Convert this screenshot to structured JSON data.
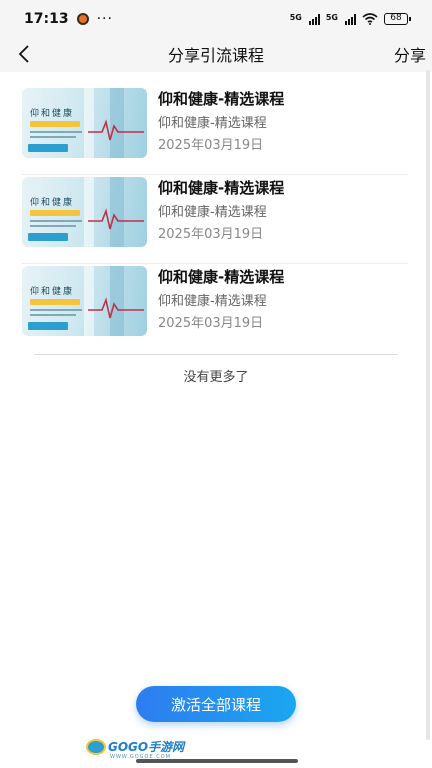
{
  "status_bar": {
    "time": "17:13",
    "dots": "···",
    "signal1_label": "5G",
    "signal2_label": "5G",
    "battery": "68"
  },
  "nav": {
    "back_icon": "chevron-left-icon",
    "title": "分享引流课程",
    "share_label": "分享"
  },
  "courses": [
    {
      "thumb_text": "仰和健康",
      "title": "仰和健康-精选课程",
      "subtitle": "仰和健康-精选课程",
      "date": "2025年03月19日"
    },
    {
      "thumb_text": "仰和健康",
      "title": "仰和健康-精选课程",
      "subtitle": "仰和健康-精选课程",
      "date": "2025年03月19日"
    },
    {
      "thumb_text": "仰和健康",
      "title": "仰和健康-精选课程",
      "subtitle": "仰和健康-精选课程",
      "date": "2025年03月19日"
    }
  ],
  "list_end_text": "没有更多了",
  "activate_button_label": "激活全部课程",
  "watermark": {
    "text": "GOGO手游网",
    "sub": "WWW.GOGOE.COM"
  },
  "colors": {
    "accent": "#2e7cf0",
    "accent_end": "#1aa7f0",
    "background": "#f5f5f5"
  }
}
